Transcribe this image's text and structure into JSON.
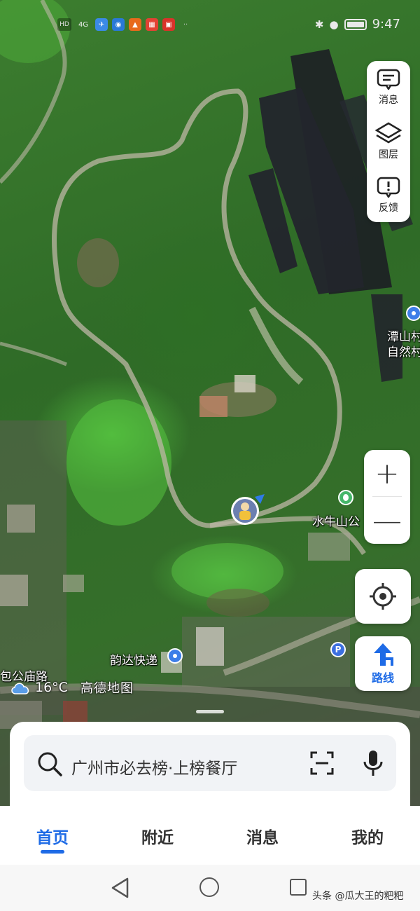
{
  "status_bar": {
    "hd": "HD",
    "signal": "4G",
    "time": "9:47"
  },
  "tools": {
    "messages": "消息",
    "layers": "图层",
    "feedback": "反馈"
  },
  "zoom": {
    "in": "+",
    "out": "—"
  },
  "route": {
    "label": "路线"
  },
  "map_labels": {
    "poi_tanshan": "潭山村",
    "poi_tanshan_2": "自然村",
    "poi_shuiniushan": "水牛山公",
    "poi_yunda": "韵达快递",
    "road": "包公庙路"
  },
  "weather": {
    "temp": "16°C",
    "brand": "高德地图"
  },
  "search": {
    "placeholder": "广州市必去榜·上榜餐厅"
  },
  "tabs": [
    {
      "label": "首页"
    },
    {
      "label": "附近"
    },
    {
      "label": "消息"
    },
    {
      "label": "我的"
    }
  ],
  "watermark": "头条 @瓜大王的粑粑",
  "colors": {
    "accent": "#1e6be6",
    "panel": "#ffffff"
  }
}
